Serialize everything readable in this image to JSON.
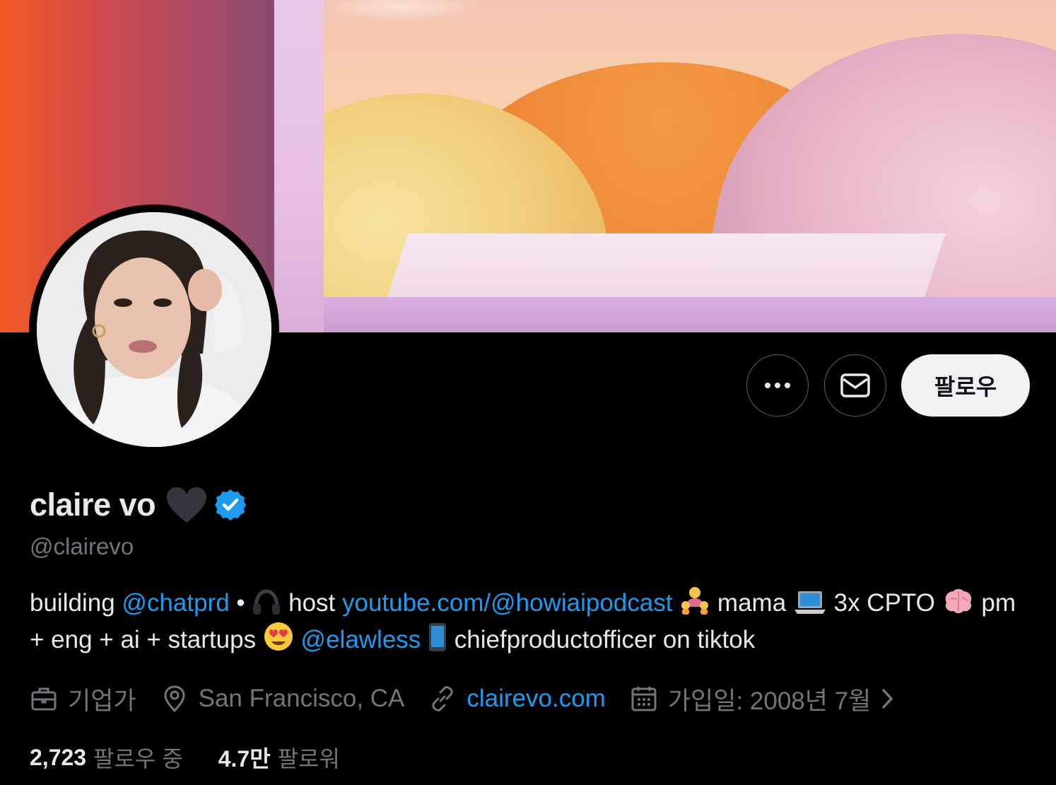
{
  "profile": {
    "name": "claire vo",
    "handle": "@clairevo",
    "follow_label": "팔로우"
  },
  "bio": {
    "t1": "building ",
    "l1": "@chatprd",
    "t2": " • ",
    "t3": " host ",
    "l2": "youtube.com/@howiaipodcast",
    "t4": " mama ",
    "t5": " 3x CPTO ",
    "t6": " pm + eng + ai + startups ",
    "l3": "@elawless",
    "t7": " chiefproductofficer on tiktok"
  },
  "meta": {
    "occupation": "기업가",
    "location": "San Francisco, CA",
    "website": "clairevo.com",
    "joined": "가입일: 2008년 7월"
  },
  "counts": {
    "following_num": "2,723",
    "following_label": "팔로우 중",
    "followers_num": "4.7만",
    "followers_label": "팔로워"
  },
  "icons": [
    "more-icon",
    "mail-icon",
    "black-heart-icon",
    "verified-badge-icon",
    "headphones-icon",
    "family-icon",
    "laptop-icon",
    "brain-icon",
    "heart-eyes-icon",
    "phone-icon",
    "briefcase-icon",
    "location-pin-icon",
    "link-icon",
    "calendar-icon",
    "chevron-right-icon"
  ],
  "colors": {
    "background": "#000000",
    "link": "#1d9bf0",
    "muted": "#71767b",
    "text": "#e7e9ea",
    "follow_button": "#eff3f4"
  }
}
